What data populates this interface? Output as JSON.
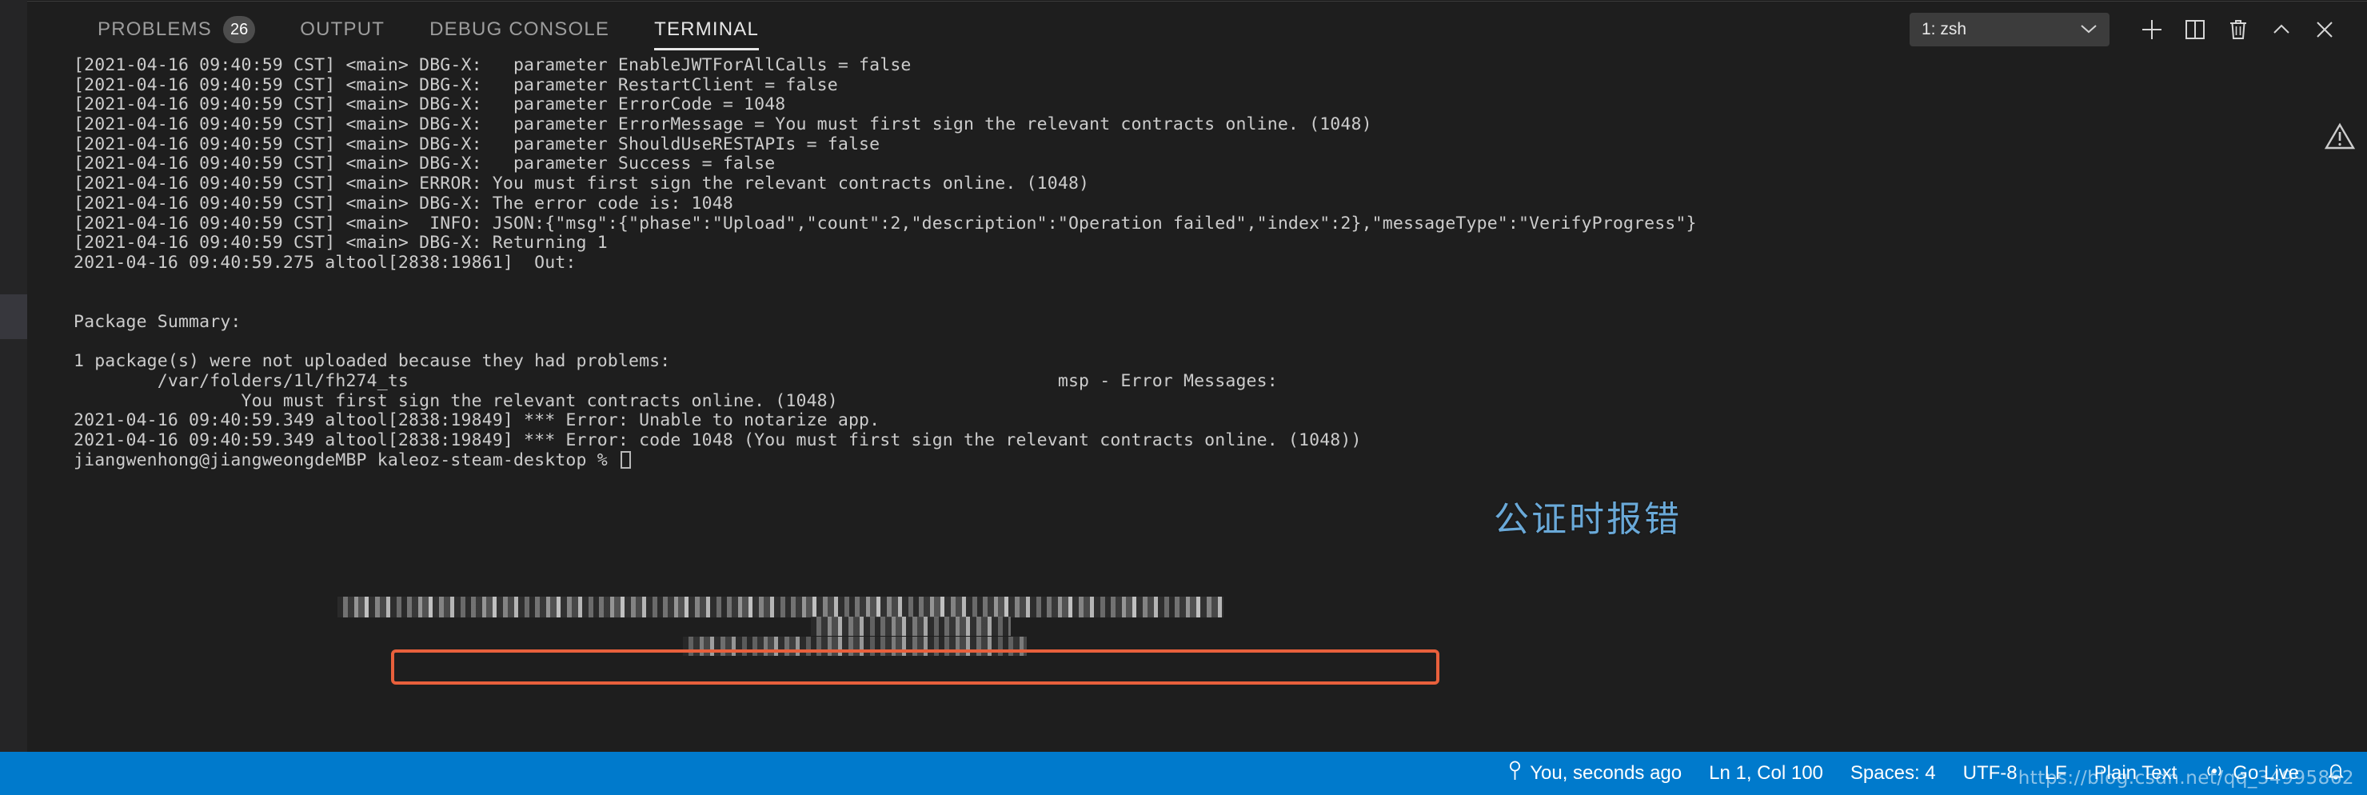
{
  "panel": {
    "tabs": [
      {
        "label": "PROBLEMS",
        "badge": "26",
        "active": false
      },
      {
        "label": "OUTPUT",
        "badge": "",
        "active": false
      },
      {
        "label": "DEBUG CONSOLE",
        "badge": "",
        "active": false
      },
      {
        "label": "TERMINAL",
        "badge": "",
        "active": true
      }
    ],
    "terminal_select": {
      "value": "1: zsh",
      "chevron": "⌄"
    },
    "actions": [
      {
        "name": "new-terminal-button",
        "icon": "plus-icon",
        "title": "New Terminal"
      },
      {
        "name": "split-terminal-button",
        "icon": "split-icon",
        "title": "Split Terminal"
      },
      {
        "name": "kill-terminal-button",
        "icon": "trash-icon",
        "title": "Kill Terminal"
      },
      {
        "name": "maximize-panel-button",
        "icon": "chevron-up-icon",
        "title": "Maximize Panel"
      },
      {
        "name": "close-panel-button",
        "icon": "close-icon",
        "title": "Close Panel"
      }
    ]
  },
  "terminal": {
    "lines": [
      "[2021-04-16 09:40:59 CST] <main> DBG-X:   parameter EnableJWTForAllCalls = false",
      "[2021-04-16 09:40:59 CST] <main> DBG-X:   parameter RestartClient = false",
      "[2021-04-16 09:40:59 CST] <main> DBG-X:   parameter ErrorCode = 1048",
      "[2021-04-16 09:40:59 CST] <main> DBG-X:   parameter ErrorMessage = You must first sign the relevant contracts online. (1048)",
      "[2021-04-16 09:40:59 CST] <main> DBG-X:   parameter ShouldUseRESTAPIs = false",
      "[2021-04-16 09:40:59 CST] <main> DBG-X:   parameter Success = false",
      "[2021-04-16 09:40:59 CST] <main> ERROR: You must first sign the relevant contracts online. (1048)",
      "[2021-04-16 09:40:59 CST] <main> DBG-X: The error code is: 1048",
      "[2021-04-16 09:40:59 CST] <main>  INFO: JSON:{\"msg\":{\"phase\":\"Upload\",\"count\":2,\"description\":\"Operation failed\",\"index\":2},\"messageType\":\"VerifyProgress\"}",
      "[2021-04-16 09:40:59 CST] <main> DBG-X: Returning 1",
      "2021-04-16 09:40:59.275 altool[2838:19861]  Out:",
      "",
      "",
      "Package Summary:",
      "",
      "1 package(s) were not uploaded because they had problems:",
      "        /var/folders/1l/fh274_ts                                                              msp - Error Messages:",
      "                You must first sign the relevant contracts online. (1048)",
      "2021-04-16 09:40:59.349 altool[2838:19849] *** Error: Unable to notarize app.",
      "2021-04-16 09:40:59.349 altool[2838:19849] *** Error: code 1048 (You must first sign the relevant contracts online. (1048))",
      "jiangwenhong@jiangweongdeMBP kaleoz-steam-desktop % "
    ]
  },
  "annotation": {
    "text": "公证时报错",
    "color": "#6aa9d8"
  },
  "highlight": {
    "color": "#e8603c",
    "target_text": "Error: code 1048 (You must first sign the relevant contracts online. (1048))"
  },
  "statusbar": {
    "background": "#007acc",
    "left_items": [
      {
        "name": "remote-sync-status",
        "icon": "git-branch-icon",
        "label": ""
      }
    ],
    "right_items": [
      {
        "name": "authorship-status",
        "icon": "lightbulb-icon",
        "label": "You, seconds ago"
      },
      {
        "name": "cursor-position-status",
        "icon": "",
        "label": "Ln 1, Col 100"
      },
      {
        "name": "indentation-status",
        "icon": "",
        "label": "Spaces: 4"
      },
      {
        "name": "encoding-status",
        "icon": "",
        "label": "UTF-8"
      },
      {
        "name": "eol-status",
        "icon": "",
        "label": "LF"
      },
      {
        "name": "language-mode-status",
        "icon": "",
        "label": "Plain Text"
      },
      {
        "name": "go-live-status",
        "icon": "broadcast-icon",
        "label": "Go Live"
      },
      {
        "name": "bell-status",
        "icon": "bell-icon",
        "label": ""
      }
    ]
  },
  "watermark": {
    "text": "https://blog.csdn.net/qq_34995862"
  }
}
